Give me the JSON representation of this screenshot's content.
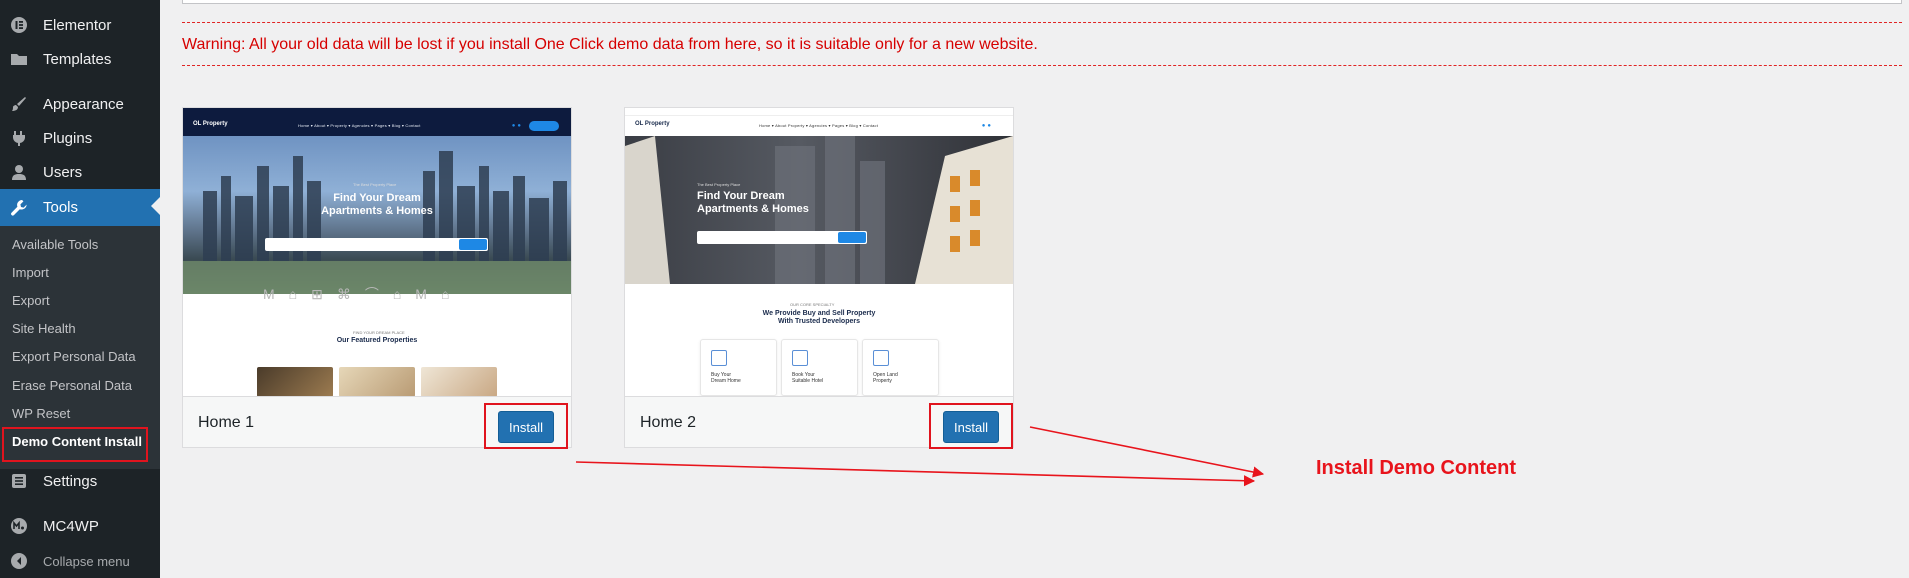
{
  "sidebar": {
    "items": [
      {
        "label": "Elementor",
        "icon": "elementor-icon"
      },
      {
        "label": "Templates",
        "icon": "folder-icon"
      },
      {
        "label": "Appearance",
        "icon": "brush-icon"
      },
      {
        "label": "Plugins",
        "icon": "plug-icon"
      },
      {
        "label": "Users",
        "icon": "user-icon"
      },
      {
        "label": "Tools",
        "icon": "wrench-icon"
      },
      {
        "label": "Settings",
        "icon": "settings-icon"
      },
      {
        "label": "MC4WP",
        "icon": "mc4wp-icon"
      },
      {
        "label": "Collapse menu",
        "icon": "collapse-icon"
      }
    ],
    "submenu": [
      "Available Tools",
      "Import",
      "Export",
      "Site Health",
      "Export Personal Data",
      "Erase Personal Data",
      "WP Reset",
      "Demo Content Install"
    ],
    "current_item": "Tools",
    "current_subitem": "Demo Content Install"
  },
  "warning": "Warning: All your old data will be lost if you install One Click demo data from here, so it is suitable only for a new website.",
  "demos": [
    {
      "name": "Home 1",
      "button": "Install",
      "preview": {
        "logo": "OL Property",
        "nav": "Home ▾  About ▾  Property ▾  Agencies ▾  Pages ▾  Blog ▾  Contact",
        "hero_kicker": "The Best Property Place",
        "hero_title_1": "Find Your Dream",
        "hero_title_2": "Apartments & Homes",
        "section_kicker": "FIND YOUR DREAM PLACE",
        "section_title": "Our Featured Properties"
      }
    },
    {
      "name": "Home 2",
      "button": "Install",
      "preview": {
        "logo": "OL Property",
        "nav": "Home ▾  About  Property ▾  Agencies ▾  Pages ▾  Blog ▾  Contact",
        "hero_kicker": "The Best Property Place",
        "hero_title_1": "Find Your Dream",
        "hero_title_2": "Apartments & Homes",
        "section_kicker": "OUR CORE SPECIALTY",
        "section_title_1": "We Provide Buy and Sell Property",
        "section_title_2": "With Trusted Developers",
        "services": [
          {
            "line1": "Buy Your",
            "line2": "Dream Home"
          },
          {
            "line1": "Book Your",
            "line2": "Suitable Hotel"
          },
          {
            "line1": "Open Land",
            "line2": "Property"
          }
        ]
      }
    }
  ],
  "annotation": {
    "label": "Install Demo Content",
    "color": "#e8141c"
  },
  "colors": {
    "sidebar_bg": "#1d2327",
    "accent": "#2271b1",
    "warning": "#d60000",
    "highlight_box": "#e0141e"
  }
}
